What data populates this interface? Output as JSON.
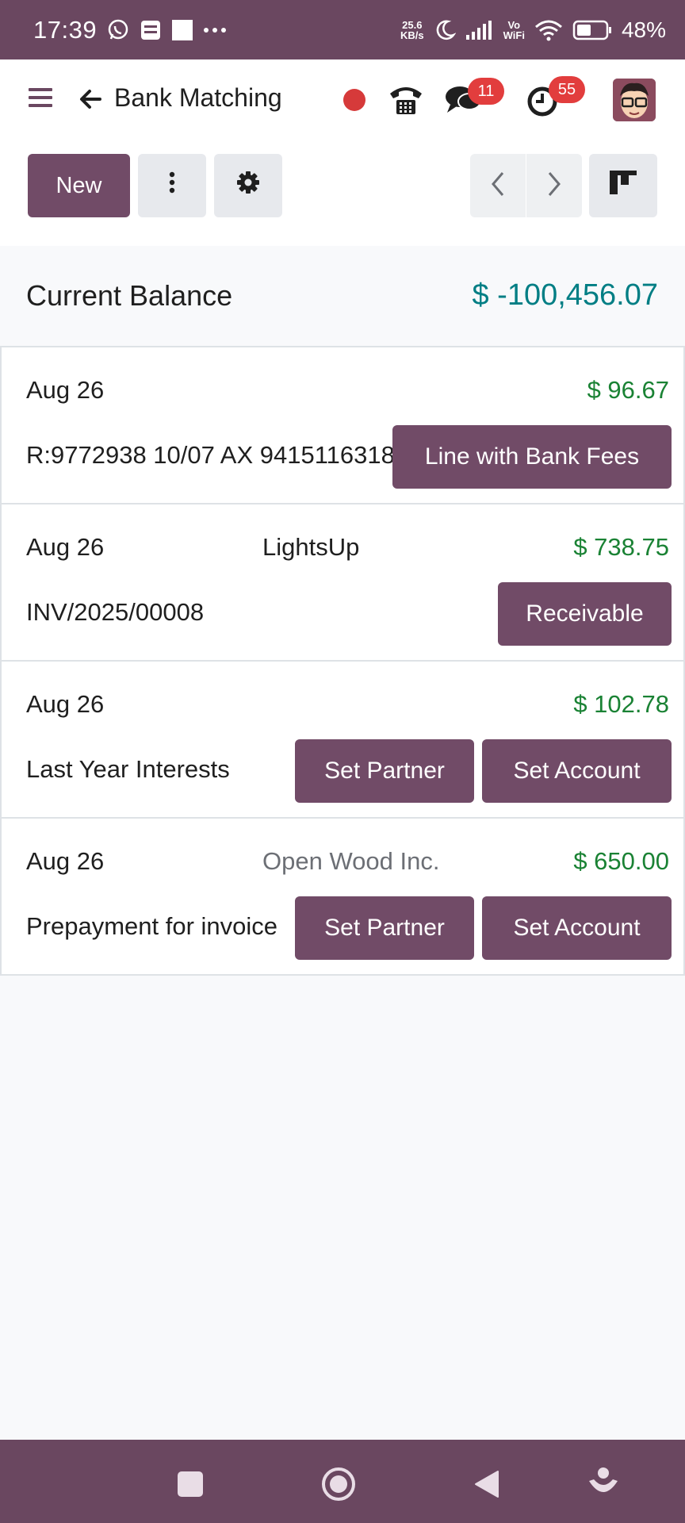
{
  "status_bar": {
    "time": "17:39",
    "speed_value": "25.6",
    "speed_unit": "KB/s",
    "network_label_top": "Vo",
    "network_label_bottom": "WiFi",
    "battery_percent": "48%"
  },
  "header": {
    "title": "Bank Matching",
    "chat_badge": "11",
    "activity_badge": "55"
  },
  "toolbar": {
    "new_label": "New"
  },
  "balance": {
    "label": "Current Balance",
    "value": "$ -100,456.07"
  },
  "transactions": [
    {
      "date": "Aug 26",
      "partner": "",
      "amount": "$ 96.67",
      "reference": "R:9772938 10/07 AX 9415116318",
      "buttons": [
        "Line with Bank Fees"
      ]
    },
    {
      "date": "Aug 26",
      "partner": "LightsUp",
      "amount": "$ 738.75",
      "reference": "INV/2025/00008",
      "buttons": [
        "Receivable"
      ]
    },
    {
      "date": "Aug 26",
      "partner": "",
      "amount": "$ 102.78",
      "reference": "Last Year Interests",
      "buttons": [
        "Set Partner",
        "Set Account"
      ]
    },
    {
      "date": "Aug 26",
      "partner": "Open Wood Inc.",
      "amount": "$ 650.00",
      "reference": "Prepayment for invoice",
      "buttons": [
        "Set Partner",
        "Set Account"
      ]
    }
  ],
  "colors": {
    "brand": "#714b67",
    "system_bar": "#6a4760",
    "balance_value": "#017e84",
    "amount_positive": "#1a8234",
    "badge": "#e23d3d"
  },
  "icons": [
    "whatsapp-icon",
    "moon-icon",
    "signal-icon",
    "wifi-icon",
    "battery-icon",
    "hamburger-icon",
    "back-arrow-icon",
    "phone-icon",
    "chat-icon",
    "activity-icon",
    "kebab-icon",
    "gear-icon",
    "chevron-left-icon",
    "chevron-right-icon",
    "kanban-icon"
  ]
}
